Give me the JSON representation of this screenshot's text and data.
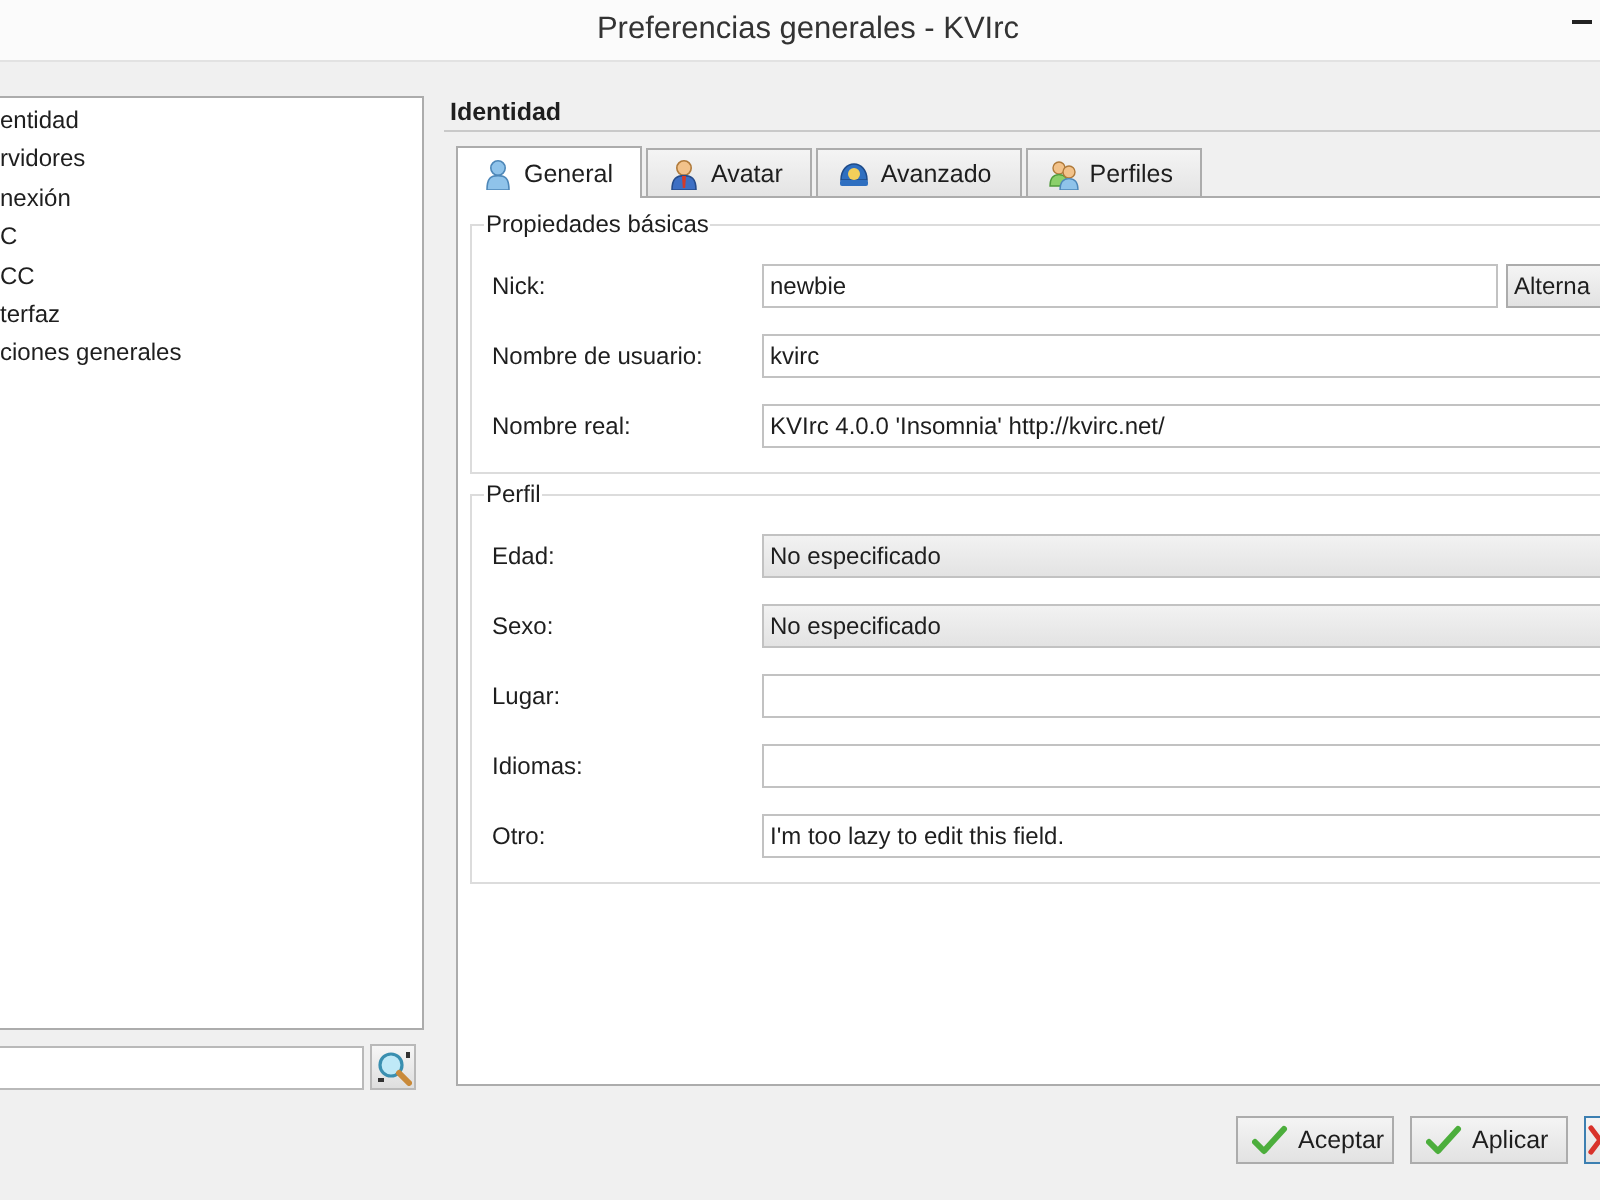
{
  "window": {
    "title": "Preferencias generales - KVIrc"
  },
  "sidebar": {
    "items": [
      {
        "label": "entidad",
        "selected": false
      },
      {
        "label": "rvidores",
        "selected": false
      },
      {
        "label": "nexión",
        "selected": false
      },
      {
        "label": "C",
        "selected": false
      },
      {
        "label": "CC",
        "selected": false
      },
      {
        "label": "terfaz",
        "selected": false
      },
      {
        "label": "ciones generales",
        "selected": false
      }
    ]
  },
  "panel": {
    "heading": "Identidad",
    "tabs": [
      {
        "label": "General",
        "selected": true
      },
      {
        "label": "Avatar",
        "selected": false
      },
      {
        "label": "Avanzado",
        "selected": false
      },
      {
        "label": "Perfiles",
        "selected": false
      }
    ],
    "groups": [
      {
        "title": "Propiedades básicas",
        "fields": [
          {
            "label": "Nick:",
            "kind": "text",
            "value": "newbie",
            "button": "Alterna"
          },
          {
            "label": "Nombre de usuario:",
            "kind": "text",
            "value": "kvirc"
          },
          {
            "label": "Nombre real:",
            "kind": "text",
            "value": "KVIrc 4.0.0 'Insomnia' http://kvirc.net/"
          }
        ]
      },
      {
        "title": "Perfil",
        "fields": [
          {
            "label": "Edad:",
            "kind": "combo",
            "value": "No especificado"
          },
          {
            "label": "Sexo:",
            "kind": "combo",
            "value": "No especificado"
          },
          {
            "label": "Lugar:",
            "kind": "text"
          },
          {
            "label": "Idiomas:",
            "kind": "text"
          },
          {
            "label": "Otro:",
            "kind": "text",
            "value": "I'm too lazy to edit this field."
          }
        ]
      }
    ]
  },
  "buttons": [
    {
      "label": "Aceptar"
    },
    {
      "label": "Aplicar"
    }
  ]
}
